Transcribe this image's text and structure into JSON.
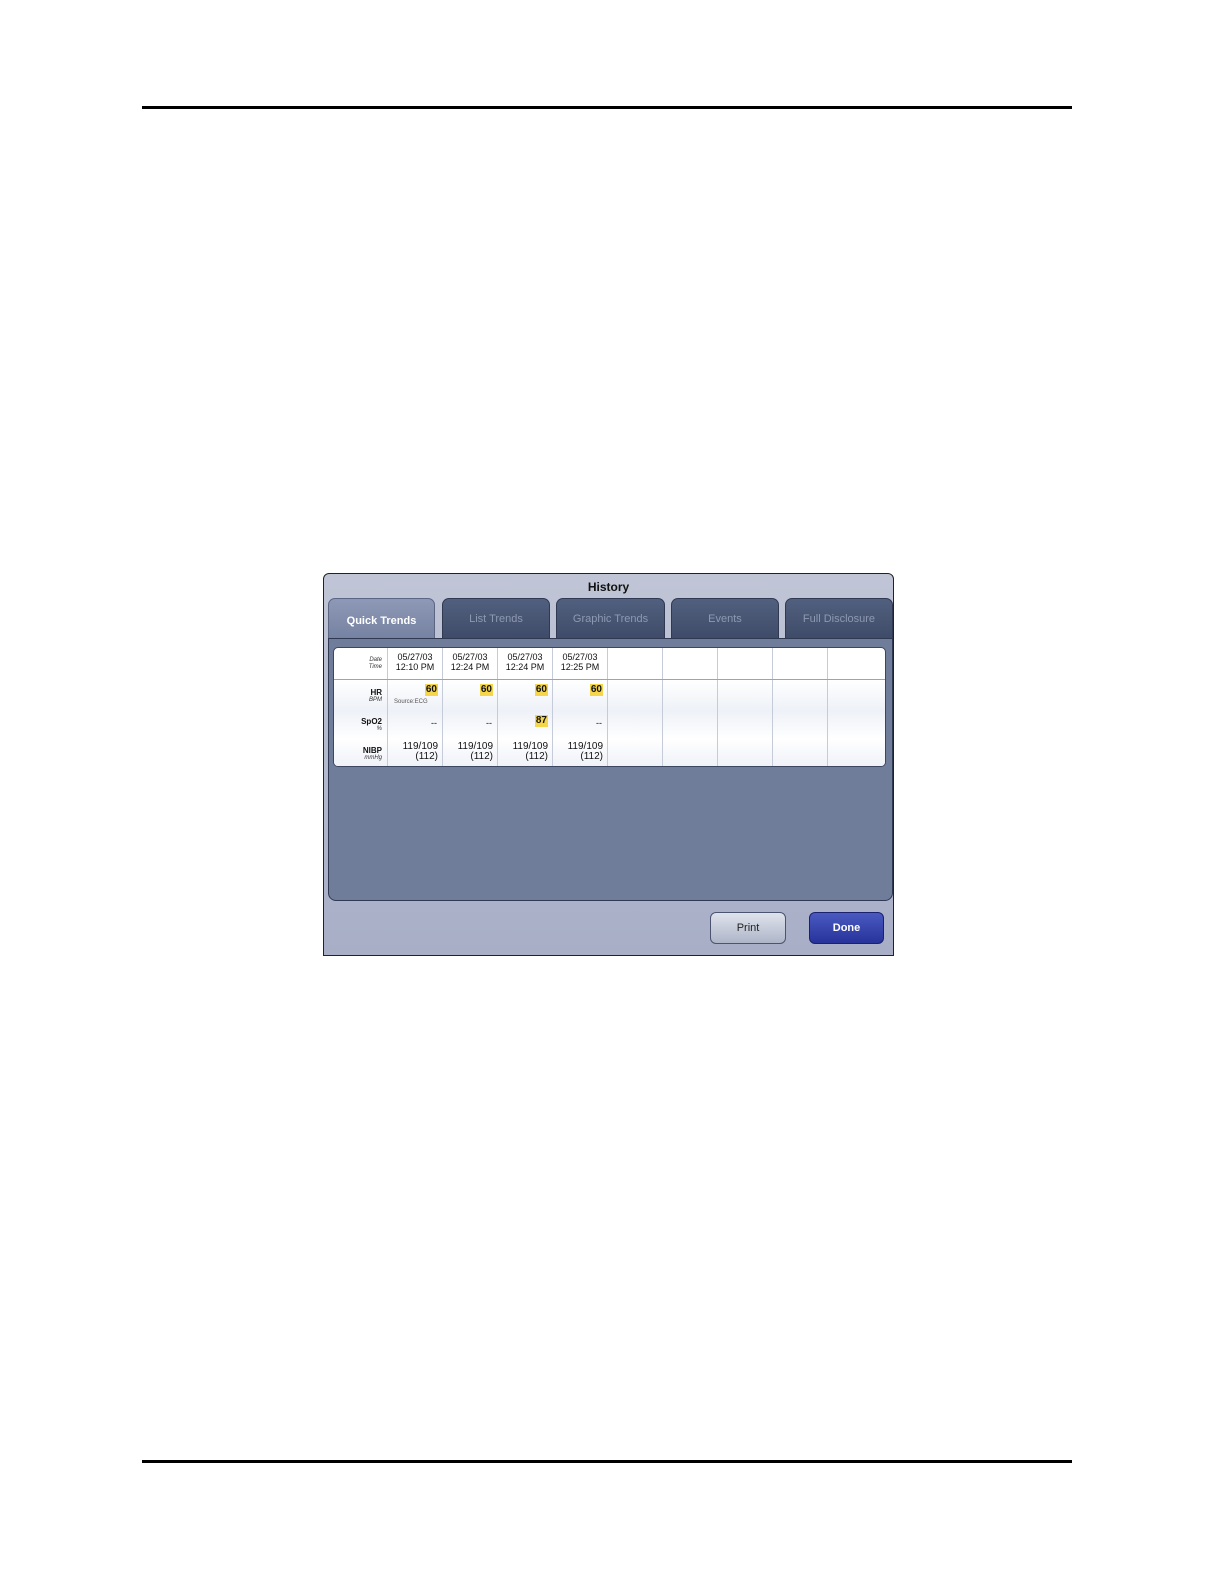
{
  "window": {
    "title": "History"
  },
  "tabs": [
    {
      "label": "Quick Trends",
      "active": true
    },
    {
      "label": "List Trends",
      "active": false
    },
    {
      "label": "Graphic Trends",
      "active": false
    },
    {
      "label": "Events",
      "active": false
    },
    {
      "label": "Full Disclosure",
      "active": false
    }
  ],
  "table": {
    "row_labels": {
      "date": {
        "main": "Date",
        "sub": "Time"
      },
      "hr": {
        "main": "HR",
        "sub": "BPM"
      },
      "spo2": {
        "main": "SpO2",
        "sub": "%"
      },
      "nibp": {
        "main": "NIBP",
        "sub": "mmHg"
      }
    },
    "columns": [
      {
        "date": "05/27/03",
        "time": "12:10 PM",
        "hr": "60",
        "hr_source": "Source:ECG",
        "spo2": "--",
        "nibp_sys_dia": "119/109",
        "nibp_mean": "(112)"
      },
      {
        "date": "05/27/03",
        "time": "12:24 PM",
        "hr": "60",
        "spo2": "--",
        "nibp_sys_dia": "119/109",
        "nibp_mean": "(112)"
      },
      {
        "date": "05/27/03",
        "time": "12:24 PM",
        "hr": "60",
        "spo2": "87",
        "nibp_sys_dia": "119/109",
        "nibp_mean": "(112)"
      },
      {
        "date": "05/27/03",
        "time": "12:25 PM",
        "hr": "60",
        "spo2": "--",
        "nibp_sys_dia": "119/109",
        "nibp_mean": "(112)"
      }
    ],
    "empty_column_count": 5,
    "highlight_color": "#f5d64a"
  },
  "buttons": {
    "print": "Print",
    "done": "Done"
  },
  "colors": {
    "panel": "#6f7d9b",
    "active_tab": "#8d99b6",
    "done_button": "#27339a"
  }
}
